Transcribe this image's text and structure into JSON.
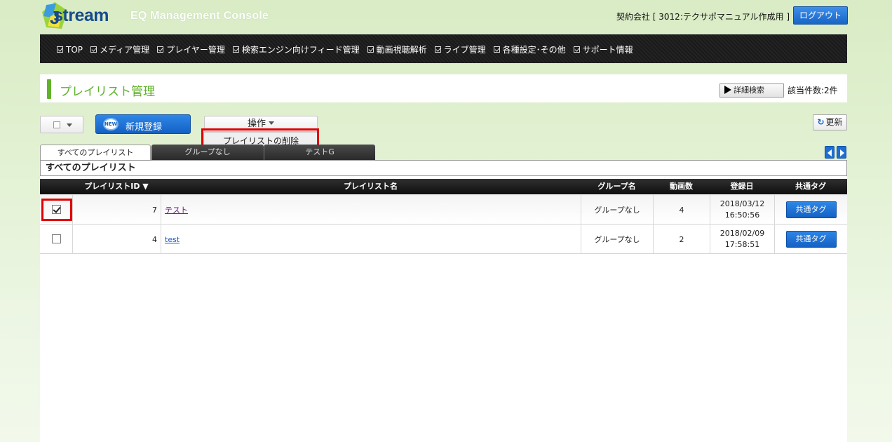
{
  "header": {
    "logo_text": "stream",
    "console_title": "EQ Management Console",
    "contract": "契約会社 [ 3012:テクサポマニュアル作成用 ]",
    "logout_label": "ログアウト"
  },
  "nav": {
    "items": [
      {
        "label": "TOP"
      },
      {
        "label": "メディア管理"
      },
      {
        "label": "プレイヤー管理"
      },
      {
        "label": "検索エンジン向けフィード管理"
      },
      {
        "label": "動画視聴解析"
      },
      {
        "label": "ライブ管理"
      },
      {
        "label": "各種設定･その他"
      },
      {
        "label": "サポート情報"
      }
    ]
  },
  "page": {
    "title": "プレイリスト管理",
    "detail_search_label": "詳細検索",
    "hit_count": "該当件数:2件"
  },
  "toolbar": {
    "new_badge": "NEW",
    "new_label": "新規登録",
    "operations_label": "操作",
    "refresh_label": "更新"
  },
  "operations_menu": {
    "items": [
      {
        "label": "プレイリストの削除"
      }
    ]
  },
  "tabs": {
    "items": [
      {
        "label": "すべてのプレイリスト",
        "active": true
      },
      {
        "label": "グループなし",
        "active": false
      },
      {
        "label": "テストG",
        "active": false
      }
    ]
  },
  "list": {
    "title": "すべてのプレイリスト",
    "columns": {
      "id": "プレイリストID ▼",
      "name": "プレイリスト名",
      "group": "グループ名",
      "video_count": "動画数",
      "registered": "登録日",
      "tag": "共通タグ"
    },
    "rows": [
      {
        "checked": true,
        "id": "7",
        "name": "テスト",
        "group": "グループなし",
        "video_count": "4",
        "date": "2018/03/12",
        "time": "16:50:56",
        "tag_label": "共通タグ"
      },
      {
        "checked": false,
        "id": "4",
        "name": "test",
        "group": "グループなし",
        "video_count": "2",
        "date": "2018/02/09",
        "time": "17:58:51",
        "tag_label": "共通タグ"
      }
    ]
  },
  "colors": {
    "accent_green": "#5fb22a",
    "button_blue": "#1461c4",
    "highlight_red": "#e00000"
  }
}
